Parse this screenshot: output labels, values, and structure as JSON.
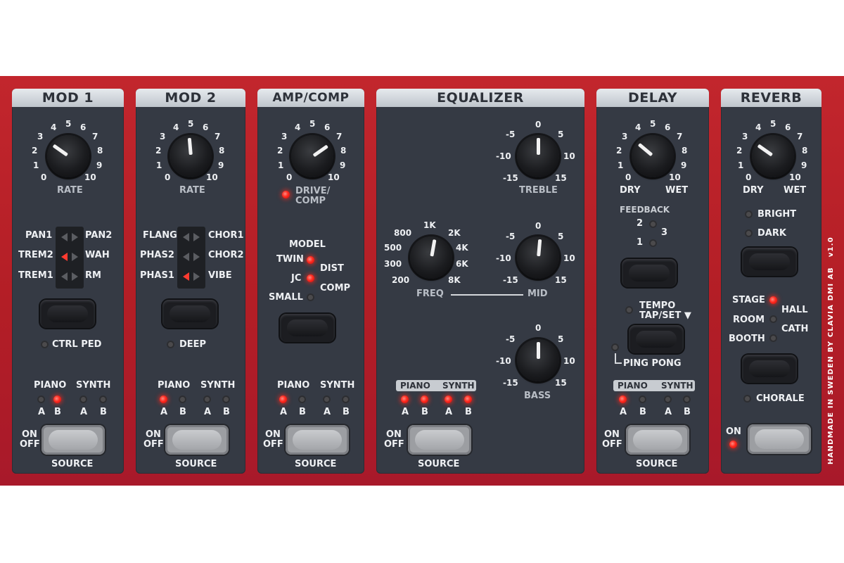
{
  "side_text": "HANDMADE IN SWEDEN BY CLAVIA DMI AB",
  "version": "v1.0",
  "common": {
    "piano": "PIANO",
    "synth": "SYNTH",
    "a": "A",
    "b": "B",
    "on": "ON",
    "off": "OFF",
    "source": "SOURCE"
  },
  "mod1": {
    "title": "MOD 1",
    "scale": [
      "0",
      "1",
      "2",
      "3",
      "4",
      "5",
      "6",
      "7",
      "8",
      "9",
      "10"
    ],
    "rate_label": "RATE",
    "waves_left": [
      "PAN1",
      "TREM2",
      "TREM1"
    ],
    "waves_right": [
      "PAN2",
      "WAH",
      "RM"
    ],
    "aux_label": "CTRL PED"
  },
  "mod2": {
    "title": "MOD 2",
    "scale": [
      "0",
      "1",
      "2",
      "3",
      "4",
      "5",
      "6",
      "7",
      "8",
      "9",
      "10"
    ],
    "rate_label": "RATE",
    "waves_left": [
      "FLANG",
      "PHAS2",
      "PHAS1"
    ],
    "waves_right": [
      "CHOR1",
      "CHOR2",
      "VIBE"
    ],
    "aux_label": "DEEP"
  },
  "amp": {
    "title": "AMP/COMP",
    "scale": [
      "0",
      "1",
      "2",
      "3",
      "4",
      "5",
      "6",
      "7",
      "8",
      "9",
      "10"
    ],
    "drive_label_1": "DRIVE/",
    "drive_label_2": "COMP",
    "model_label": "MODEL",
    "twin": "TWIN",
    "jc": "JC",
    "small": "SMALL",
    "dist": "DIST",
    "comp": "COMP"
  },
  "eq": {
    "title": "EQUALIZER",
    "freq_scale": [
      "200",
      "300",
      "500",
      "800",
      "1K",
      "2K",
      "4K",
      "6K",
      "8K"
    ],
    "freq_label": "FREQ",
    "gain_scale": [
      "-15",
      "-10",
      "-5",
      "0",
      "5",
      "10",
      "15"
    ],
    "treble_label": "TREBLE",
    "mid_label": "MID",
    "bass_label": "BASS"
  },
  "delay": {
    "title": "DELAY",
    "scale": [
      "0",
      "1",
      "2",
      "3",
      "4",
      "5",
      "6",
      "7",
      "8",
      "9",
      "10"
    ],
    "dry": "DRY",
    "wet": "WET",
    "feedback_label": "FEEDBACK",
    "fb1": "1",
    "fb2": "2",
    "fb3": "3",
    "tempo": "TEMPO",
    "tapset": "TAP/SET ▼",
    "pingpong": "PING PONG"
  },
  "reverb": {
    "title": "REVERB",
    "scale": [
      "0",
      "1",
      "2",
      "3",
      "4",
      "5",
      "6",
      "7",
      "8",
      "9",
      "10"
    ],
    "dry": "DRY",
    "wet": "WET",
    "bright": "BRIGHT",
    "dark": "DARK",
    "stage": "STAGE",
    "hall": "HALL",
    "room": "ROOM",
    "cath": "CATH",
    "booth": "BOOTH",
    "chorale": "CHORALE"
  }
}
